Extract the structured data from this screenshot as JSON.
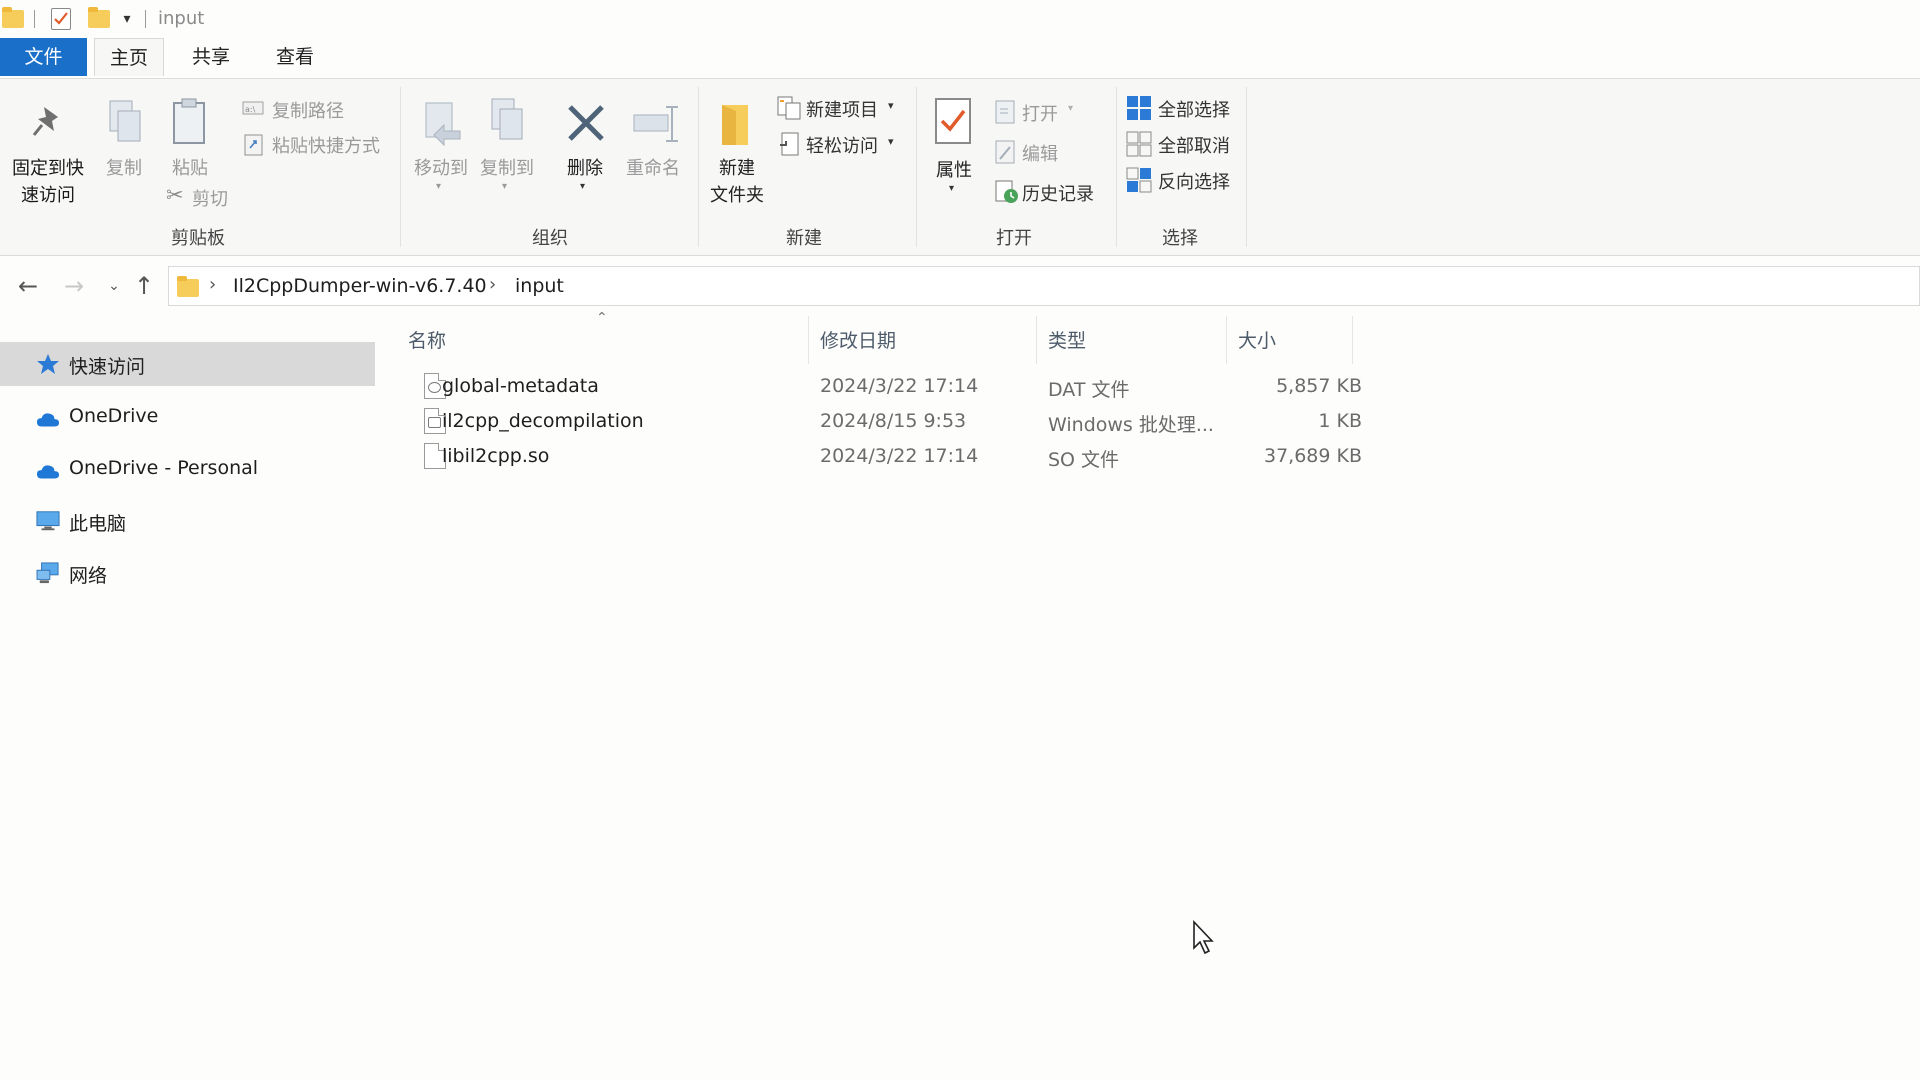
{
  "window": {
    "title": "input"
  },
  "ribbon_tabs": [
    {
      "label": "文件"
    },
    {
      "label": "主页"
    },
    {
      "label": "共享"
    },
    {
      "label": "查看"
    }
  ],
  "ribbon": {
    "clipboard": {
      "pin_label_1": "固定到快",
      "pin_label_2": "速访问",
      "copy_label": "复制",
      "paste_label": "粘贴",
      "copy_path_label": "复制路径",
      "paste_shortcut_label": "粘贴快捷方式",
      "cut_label": "剪切",
      "group_label": "剪贴板"
    },
    "organize": {
      "move_to_label": "移动到",
      "copy_to_label": "复制到",
      "delete_label": "删除",
      "rename_label": "重命名",
      "group_label": "组织"
    },
    "new": {
      "new_folder_label_1": "新建",
      "new_folder_label_2": "文件夹",
      "new_item_label": "新建项目",
      "easy_access_label": "轻松访问",
      "group_label": "新建"
    },
    "open": {
      "properties_label": "属性",
      "open_label": "打开",
      "edit_label": "编辑",
      "history_label": "历史记录",
      "group_label": "打开"
    },
    "select": {
      "select_all_label": "全部选择",
      "select_none_label": "全部取消",
      "invert_label": "反向选择",
      "group_label": "选择"
    }
  },
  "address": {
    "crumbs": [
      {
        "label": "Il2CppDumper-win-v6.7.40"
      },
      {
        "label": "input"
      }
    ]
  },
  "sidebar": {
    "items": [
      {
        "label": "快速访问",
        "icon": "star-icon"
      },
      {
        "label": "OneDrive",
        "icon": "cloud-icon"
      },
      {
        "label": "OneDrive - Personal",
        "icon": "cloud-icon"
      },
      {
        "label": "此电脑",
        "icon": "computer-icon"
      },
      {
        "label": "网络",
        "icon": "network-icon"
      }
    ]
  },
  "filelist": {
    "columns": {
      "name": "名称",
      "modified": "修改日期",
      "type": "类型",
      "size": "大小"
    },
    "rows": [
      {
        "name": "global-metadata",
        "modified": "2024/3/22 17:14",
        "type": "DAT 文件",
        "size": "5,857 KB"
      },
      {
        "name": "il2cpp_decompilation",
        "modified": "2024/8/15 9:53",
        "type": "Windows 批处理...",
        "size": "1 KB"
      },
      {
        "name": "libil2cpp.so",
        "modified": "2024/3/22 17:14",
        "type": "SO 文件",
        "size": "37,689 KB"
      }
    ]
  },
  "colors": {
    "file_tab": "#1a6fc9",
    "folder": "#f6cc5a",
    "accent_blue": "#2b7bd6"
  }
}
